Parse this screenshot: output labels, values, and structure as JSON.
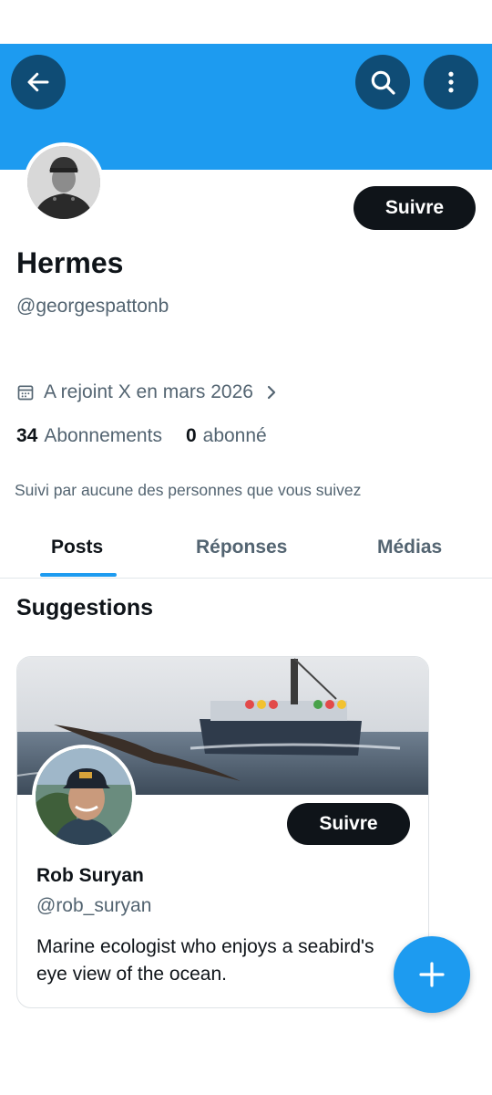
{
  "header": {
    "back_icon": "arrow-left-icon",
    "search_icon": "search-icon",
    "more_icon": "more-vertical-icon",
    "banner_color": "#1d9bf0"
  },
  "profile": {
    "name": "Hermes",
    "handle": "@georgespattonb",
    "follow_label": "Suivre",
    "joined_text": "A rejoint X en mars 2026",
    "following_count": "34",
    "following_label": "Abonnements",
    "followers_count": "0",
    "followers_label": "abonné",
    "followed_by_text": "Suivi par aucune des personnes que vous suivez"
  },
  "tabs": [
    {
      "label": "Posts",
      "active": true
    },
    {
      "label": "Réponses",
      "active": false
    },
    {
      "label": "Médias",
      "active": false
    }
  ],
  "suggestions": {
    "title": "Suggestions",
    "card": {
      "name": "Rob Suryan",
      "handle": "@rob_suryan",
      "follow_label": "Suivre",
      "bio": "Marine ecologist who enjoys a seabird's eye view of the ocean."
    }
  },
  "fab": {
    "icon": "plus-icon"
  },
  "colors": {
    "accent": "#1d9bf0",
    "dark": "#0f1419",
    "muted": "#536471"
  }
}
